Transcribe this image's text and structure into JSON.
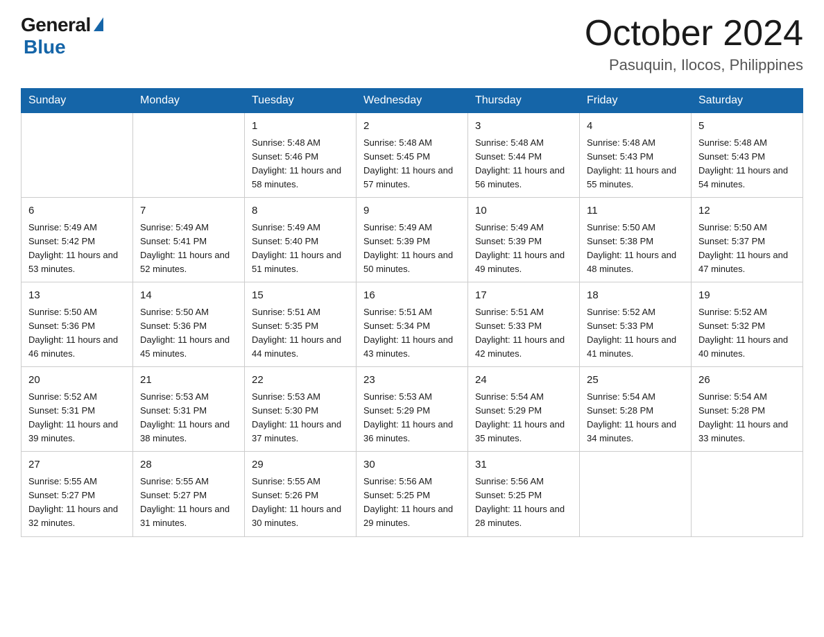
{
  "logo": {
    "general": "General",
    "blue": "Blue"
  },
  "title": {
    "month": "October 2024",
    "location": "Pasuquin, Ilocos, Philippines"
  },
  "headers": [
    "Sunday",
    "Monday",
    "Tuesday",
    "Wednesday",
    "Thursday",
    "Friday",
    "Saturday"
  ],
  "weeks": [
    [
      {
        "day": "",
        "sunrise": "",
        "sunset": "",
        "daylight": ""
      },
      {
        "day": "",
        "sunrise": "",
        "sunset": "",
        "daylight": ""
      },
      {
        "day": "1",
        "sunrise": "Sunrise: 5:48 AM",
        "sunset": "Sunset: 5:46 PM",
        "daylight": "Daylight: 11 hours and 58 minutes."
      },
      {
        "day": "2",
        "sunrise": "Sunrise: 5:48 AM",
        "sunset": "Sunset: 5:45 PM",
        "daylight": "Daylight: 11 hours and 57 minutes."
      },
      {
        "day": "3",
        "sunrise": "Sunrise: 5:48 AM",
        "sunset": "Sunset: 5:44 PM",
        "daylight": "Daylight: 11 hours and 56 minutes."
      },
      {
        "day": "4",
        "sunrise": "Sunrise: 5:48 AM",
        "sunset": "Sunset: 5:43 PM",
        "daylight": "Daylight: 11 hours and 55 minutes."
      },
      {
        "day": "5",
        "sunrise": "Sunrise: 5:48 AM",
        "sunset": "Sunset: 5:43 PM",
        "daylight": "Daylight: 11 hours and 54 minutes."
      }
    ],
    [
      {
        "day": "6",
        "sunrise": "Sunrise: 5:49 AM",
        "sunset": "Sunset: 5:42 PM",
        "daylight": "Daylight: 11 hours and 53 minutes."
      },
      {
        "day": "7",
        "sunrise": "Sunrise: 5:49 AM",
        "sunset": "Sunset: 5:41 PM",
        "daylight": "Daylight: 11 hours and 52 minutes."
      },
      {
        "day": "8",
        "sunrise": "Sunrise: 5:49 AM",
        "sunset": "Sunset: 5:40 PM",
        "daylight": "Daylight: 11 hours and 51 minutes."
      },
      {
        "day": "9",
        "sunrise": "Sunrise: 5:49 AM",
        "sunset": "Sunset: 5:39 PM",
        "daylight": "Daylight: 11 hours and 50 minutes."
      },
      {
        "day": "10",
        "sunrise": "Sunrise: 5:49 AM",
        "sunset": "Sunset: 5:39 PM",
        "daylight": "Daylight: 11 hours and 49 minutes."
      },
      {
        "day": "11",
        "sunrise": "Sunrise: 5:50 AM",
        "sunset": "Sunset: 5:38 PM",
        "daylight": "Daylight: 11 hours and 48 minutes."
      },
      {
        "day": "12",
        "sunrise": "Sunrise: 5:50 AM",
        "sunset": "Sunset: 5:37 PM",
        "daylight": "Daylight: 11 hours and 47 minutes."
      }
    ],
    [
      {
        "day": "13",
        "sunrise": "Sunrise: 5:50 AM",
        "sunset": "Sunset: 5:36 PM",
        "daylight": "Daylight: 11 hours and 46 minutes."
      },
      {
        "day": "14",
        "sunrise": "Sunrise: 5:50 AM",
        "sunset": "Sunset: 5:36 PM",
        "daylight": "Daylight: 11 hours and 45 minutes."
      },
      {
        "day": "15",
        "sunrise": "Sunrise: 5:51 AM",
        "sunset": "Sunset: 5:35 PM",
        "daylight": "Daylight: 11 hours and 44 minutes."
      },
      {
        "day": "16",
        "sunrise": "Sunrise: 5:51 AM",
        "sunset": "Sunset: 5:34 PM",
        "daylight": "Daylight: 11 hours and 43 minutes."
      },
      {
        "day": "17",
        "sunrise": "Sunrise: 5:51 AM",
        "sunset": "Sunset: 5:33 PM",
        "daylight": "Daylight: 11 hours and 42 minutes."
      },
      {
        "day": "18",
        "sunrise": "Sunrise: 5:52 AM",
        "sunset": "Sunset: 5:33 PM",
        "daylight": "Daylight: 11 hours and 41 minutes."
      },
      {
        "day": "19",
        "sunrise": "Sunrise: 5:52 AM",
        "sunset": "Sunset: 5:32 PM",
        "daylight": "Daylight: 11 hours and 40 minutes."
      }
    ],
    [
      {
        "day": "20",
        "sunrise": "Sunrise: 5:52 AM",
        "sunset": "Sunset: 5:31 PM",
        "daylight": "Daylight: 11 hours and 39 minutes."
      },
      {
        "day": "21",
        "sunrise": "Sunrise: 5:53 AM",
        "sunset": "Sunset: 5:31 PM",
        "daylight": "Daylight: 11 hours and 38 minutes."
      },
      {
        "day": "22",
        "sunrise": "Sunrise: 5:53 AM",
        "sunset": "Sunset: 5:30 PM",
        "daylight": "Daylight: 11 hours and 37 minutes."
      },
      {
        "day": "23",
        "sunrise": "Sunrise: 5:53 AM",
        "sunset": "Sunset: 5:29 PM",
        "daylight": "Daylight: 11 hours and 36 minutes."
      },
      {
        "day": "24",
        "sunrise": "Sunrise: 5:54 AM",
        "sunset": "Sunset: 5:29 PM",
        "daylight": "Daylight: 11 hours and 35 minutes."
      },
      {
        "day": "25",
        "sunrise": "Sunrise: 5:54 AM",
        "sunset": "Sunset: 5:28 PM",
        "daylight": "Daylight: 11 hours and 34 minutes."
      },
      {
        "day": "26",
        "sunrise": "Sunrise: 5:54 AM",
        "sunset": "Sunset: 5:28 PM",
        "daylight": "Daylight: 11 hours and 33 minutes."
      }
    ],
    [
      {
        "day": "27",
        "sunrise": "Sunrise: 5:55 AM",
        "sunset": "Sunset: 5:27 PM",
        "daylight": "Daylight: 11 hours and 32 minutes."
      },
      {
        "day": "28",
        "sunrise": "Sunrise: 5:55 AM",
        "sunset": "Sunset: 5:27 PM",
        "daylight": "Daylight: 11 hours and 31 minutes."
      },
      {
        "day": "29",
        "sunrise": "Sunrise: 5:55 AM",
        "sunset": "Sunset: 5:26 PM",
        "daylight": "Daylight: 11 hours and 30 minutes."
      },
      {
        "day": "30",
        "sunrise": "Sunrise: 5:56 AM",
        "sunset": "Sunset: 5:25 PM",
        "daylight": "Daylight: 11 hours and 29 minutes."
      },
      {
        "day": "31",
        "sunrise": "Sunrise: 5:56 AM",
        "sunset": "Sunset: 5:25 PM",
        "daylight": "Daylight: 11 hours and 28 minutes."
      },
      {
        "day": "",
        "sunrise": "",
        "sunset": "",
        "daylight": ""
      },
      {
        "day": "",
        "sunrise": "",
        "sunset": "",
        "daylight": ""
      }
    ]
  ]
}
